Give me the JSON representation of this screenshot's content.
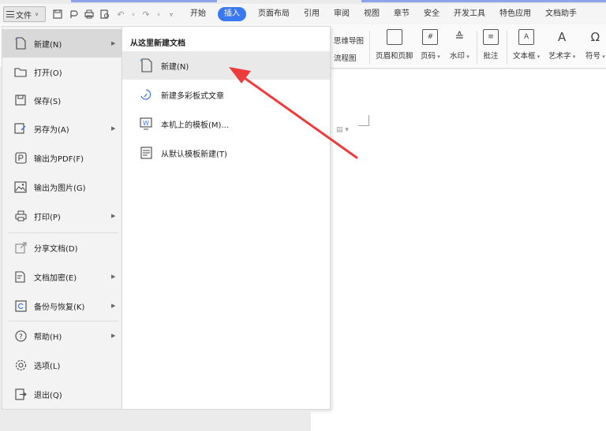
{
  "toolbar": {
    "file_label": "文件",
    "tabs": [
      "开始",
      "插入",
      "页面布局",
      "引用",
      "审阅",
      "视图",
      "章节",
      "安全",
      "开发工具",
      "特色应用",
      "文档助手"
    ],
    "active_tab": "插入"
  },
  "ribbon": {
    "mindmap": "思维导图",
    "flowchart": "流程图",
    "header_footer": "页眉和页脚",
    "page_number": "页码",
    "watermark": "水印",
    "comment": "批注",
    "textbox": "文本框",
    "wordart": "艺术字",
    "symbol": "符号"
  },
  "file_menu": {
    "items": [
      {
        "label": "新建(N)",
        "icon": "new-doc-icon",
        "has_submenu": true
      },
      {
        "label": "打开(O)",
        "icon": "folder-icon",
        "has_submenu": false
      },
      {
        "label": "保存(S)",
        "icon": "save-icon",
        "has_submenu": false
      },
      {
        "label": "另存为(A)",
        "icon": "save-as-icon",
        "has_submenu": true
      },
      {
        "label": "输出为PDF(F)",
        "icon": "pdf-icon",
        "has_submenu": false
      },
      {
        "label": "输出为图片(G)",
        "icon": "image-icon",
        "has_submenu": false
      },
      {
        "label": "打印(P)",
        "icon": "print-icon",
        "has_submenu": true
      },
      {
        "label": "分享文档(D)",
        "icon": "share-icon",
        "has_submenu": false
      },
      {
        "label": "文档加密(E)",
        "icon": "encrypt-icon",
        "has_submenu": true
      },
      {
        "label": "备份与恢复(K)",
        "icon": "backup-icon",
        "has_submenu": true
      },
      {
        "label": "帮助(H)",
        "icon": "help-icon",
        "has_submenu": true
      },
      {
        "label": "选项(L)",
        "icon": "gear-icon",
        "has_submenu": false
      },
      {
        "label": "退出(Q)",
        "icon": "exit-icon",
        "has_submenu": false
      }
    ]
  },
  "sub_menu": {
    "title": "从这里新建文档",
    "items": [
      {
        "label": "新建(N)",
        "icon": "blank-doc-icon"
      },
      {
        "label": "新建多彩板式文章",
        "icon": "colorful-article-icon"
      },
      {
        "label": "本机上的模板(M)...",
        "icon": "template-icon"
      },
      {
        "label": "从默认模板新建(T)",
        "icon": "default-template-icon"
      }
    ]
  },
  "colors": {
    "accent": "#3a78f2",
    "annotation_arrow": "#ee3b3b"
  }
}
